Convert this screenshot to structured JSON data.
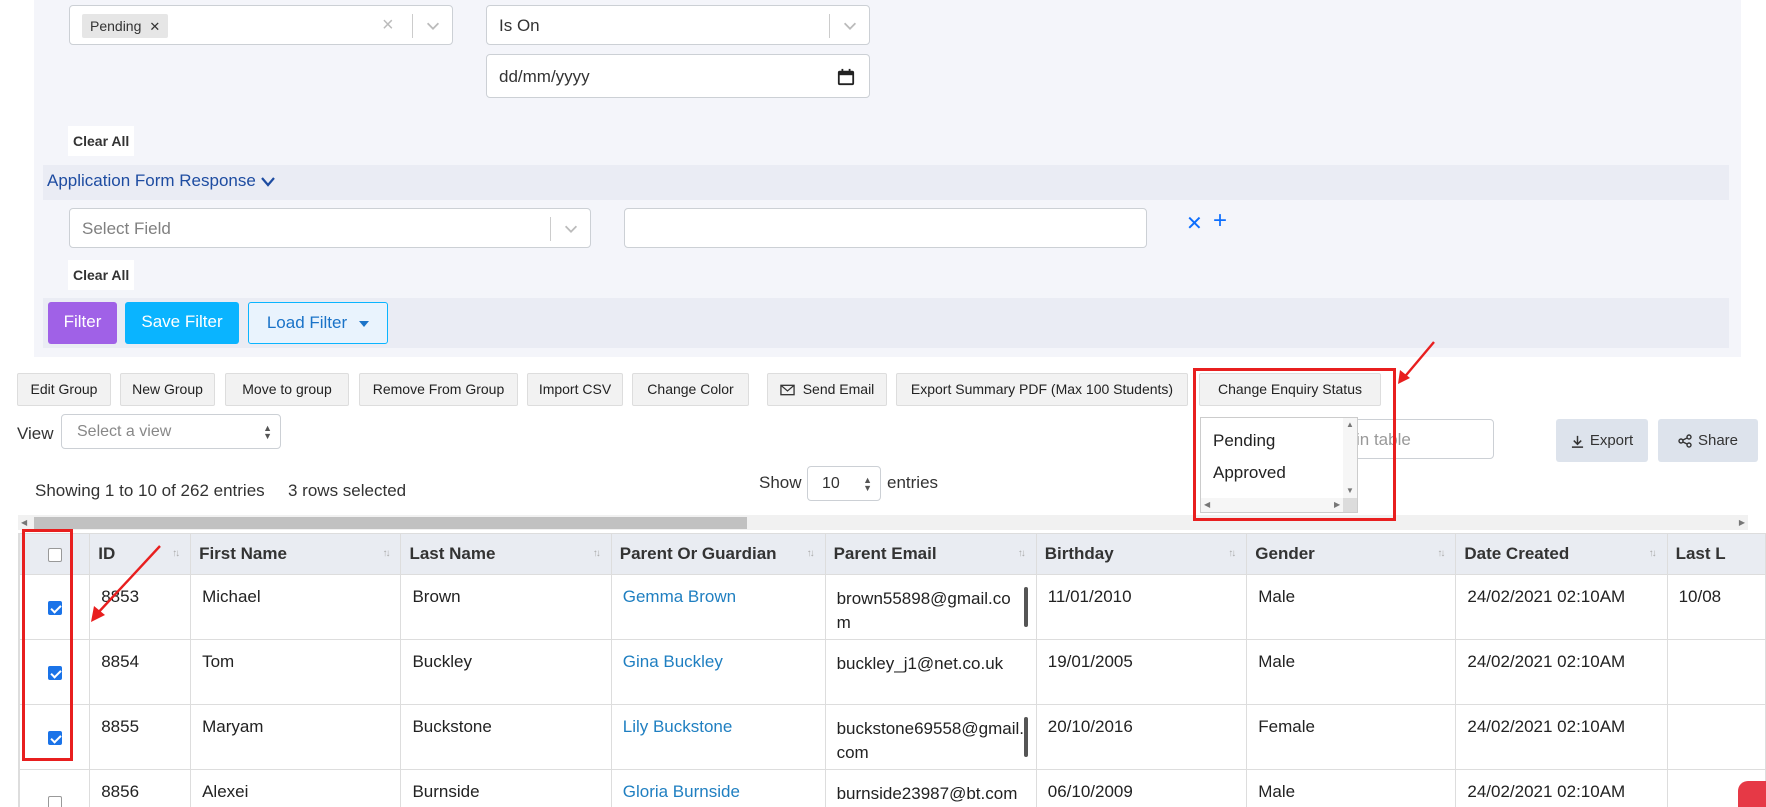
{
  "filters": {
    "status_tag": "Pending",
    "condition_select": "Is On",
    "date_placeholder": "dd/mm/yyyy",
    "clear_all_1": "Clear All",
    "clear_all_2": "Clear All",
    "application_section": "Application Form Response",
    "select_field_placeholder": "Select Field",
    "value_input": ""
  },
  "actions": {
    "filter": "Filter",
    "save_filter": "Save Filter",
    "load_filter": "Load Filter"
  },
  "toolbar": {
    "edit_group": "Edit Group",
    "new_group": "New Group",
    "move_to_group": "Move to group",
    "remove_from_group": "Remove From Group",
    "import_csv": "Import CSV",
    "change_color": "Change Color",
    "send_email": "Send Email",
    "export_summary": "Export Summary PDF (Max 100 Students)",
    "change_enquiry_status": "Change Enquiry Status"
  },
  "status_dropdown": {
    "options": [
      "Pending",
      "Approved"
    ]
  },
  "view": {
    "label": "View",
    "placeholder": "Select a view"
  },
  "search": {
    "placeholder_visible": "in table"
  },
  "export_buttons": {
    "export": "Export",
    "share": "Share"
  },
  "table_info": {
    "showing": "Showing 1 to 10 of 262 entries",
    "selected": "3 rows selected",
    "show_label": "Show",
    "entries_value": "10",
    "entries_label": "entries"
  },
  "table": {
    "columns": [
      "ID",
      "First Name",
      "Last Name",
      "Parent Or Guardian",
      "Parent Email",
      "Birthday",
      "Gender",
      "Date Created",
      "Last L"
    ],
    "rows": [
      {
        "checked": true,
        "id": "8853",
        "first": "Michael",
        "last": "Brown",
        "parent": "Gemma Brown",
        "email": "brown55898@gmail.com",
        "birthday": "11/01/2010",
        "gender": "Male",
        "created": "24/02/2021 02:10AM",
        "lastl": "10/08"
      },
      {
        "checked": true,
        "id": "8854",
        "first": "Tom",
        "last": "Buckley",
        "parent": "Gina Buckley",
        "email": "buckley_j1@net.co.uk",
        "birthday": "19/01/2005",
        "gender": "Male",
        "created": "24/02/2021 02:10AM",
        "lastl": ""
      },
      {
        "checked": true,
        "id": "8855",
        "first": "Maryam",
        "last": "Buckstone",
        "parent": "Lily Buckstone",
        "email": "buckstone69558@gmail.com",
        "birthday": "20/10/2016",
        "gender": "Female",
        "created": "24/02/2021 02:10AM",
        "lastl": ""
      },
      {
        "checked": false,
        "id": "8856",
        "first": "Alexei",
        "last": "Burnside",
        "parent": "Gloria Burnside",
        "email": "burnside23987@bt.com",
        "birthday": "06/10/2009",
        "gender": "Male",
        "created": "24/02/2021 02:10AM",
        "lastl": ""
      }
    ]
  },
  "colors": {
    "filter_button": "#a061e7",
    "save_button": "#0ab4ff",
    "annotation_red": "#e81f1f",
    "link_blue": "#1f7fc1"
  }
}
